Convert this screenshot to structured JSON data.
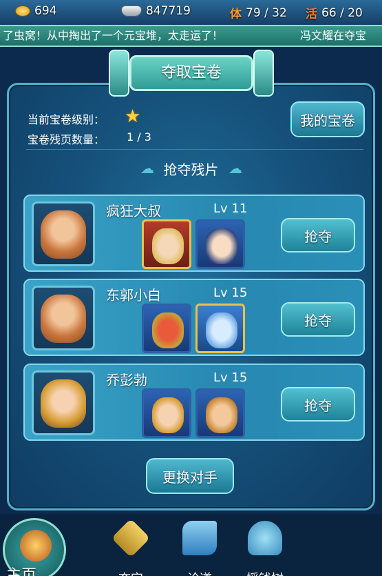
{
  "topbar": {
    "gold": "694",
    "silver": "847719",
    "stamina_label": "体",
    "stamina": "79 / 32",
    "vitality_label": "活",
    "vitality": "66 / 20"
  },
  "ticker": {
    "message_1": "了虫窝！从中掏出了一个元宝堆，太走运了！",
    "message_2": "冯文耀在夺宝"
  },
  "panel": {
    "title": "夺取宝卷",
    "level_label": "当前宝卷级别：",
    "fragment_label": "宝卷残页数量：",
    "fragment_count": "1 / 3",
    "my_scroll_button": "我的宝卷",
    "section_title": "抢夺残片",
    "change_button": "更换对手"
  },
  "opponents": [
    {
      "name": "疯狂大叔",
      "level": "Lv 11",
      "action": "抢夺"
    },
    {
      "name": "东郭小白",
      "level": "Lv 15",
      "action": "抢夺"
    },
    {
      "name": "乔彭勃",
      "level": "Lv 15",
      "action": "抢夺"
    }
  ],
  "nav": {
    "home": "主页",
    "items": [
      "夺宝",
      "论道",
      "摇钱树"
    ]
  },
  "colors": {
    "accent": "#4fb3c8",
    "panel": "#16527c",
    "button": "#1c7894"
  }
}
